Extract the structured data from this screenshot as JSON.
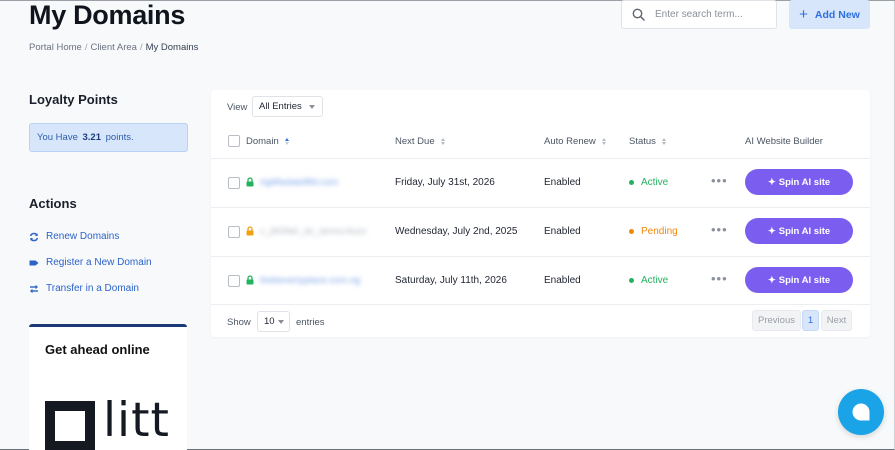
{
  "page": {
    "title": "My Domains"
  },
  "breadcrumb": [
    "Portal Home",
    "Client Area",
    "My Domains"
  ],
  "header": {
    "search_placeholder": "Enter search term...",
    "add_new_label": "Add New"
  },
  "sidebar": {
    "loyalty": {
      "heading": "Loyalty Points",
      "prefix": "You Have",
      "points": "3.21",
      "suffix": "points."
    },
    "actions": {
      "heading": "Actions",
      "items": [
        {
          "label": "Renew Domains",
          "icon": "refresh-icon"
        },
        {
          "label": "Register a New Domain",
          "icon": "tag-icon"
        },
        {
          "label": "Transfer in a Domain",
          "icon": "transfer-icon"
        }
      ]
    },
    "promo": {
      "title": "Get ahead online",
      "logo_text": "litt"
    }
  },
  "table": {
    "view_label": "View",
    "view_selected": "All Entries",
    "columns": [
      "Domain",
      "Next Due",
      "Auto Renew",
      "Status",
      "AI Website Builder"
    ],
    "rows": [
      {
        "domain": "rigilifadatellfld.com",
        "next_due": "Friday, July 31st, 2026",
        "auto_renew": "Enabled",
        "status": "Active",
        "lock_color": "#22b35e",
        "action": "Spin AI site"
      },
      {
        "domain": "c_j9t2fa0_dz_dzmcc4uzx",
        "next_due": "Wednesday, July 2nd, 2025",
        "auto_renew": "Enabled",
        "status": "Pending",
        "lock_color": "#f0a010",
        "action": "Spin AI site"
      },
      {
        "domain": "thebeveriyplace.com.ng",
        "next_due": "Saturday, July 11th, 2026",
        "auto_renew": "Enabled",
        "status": "Active",
        "lock_color": "#22b35e",
        "action": "Spin AI site"
      }
    ],
    "footer": {
      "show_label": "Show",
      "page_size": "10",
      "entries_label": "entries",
      "previous_label": "Previous",
      "current_page": "1",
      "next_label": "Next"
    }
  },
  "colors": {
    "accent": "#2e6fe0",
    "active": "#22b35e",
    "pending": "#f0880a",
    "spin_button": "#7b5ef0",
    "chat": "#1aa3e6"
  }
}
